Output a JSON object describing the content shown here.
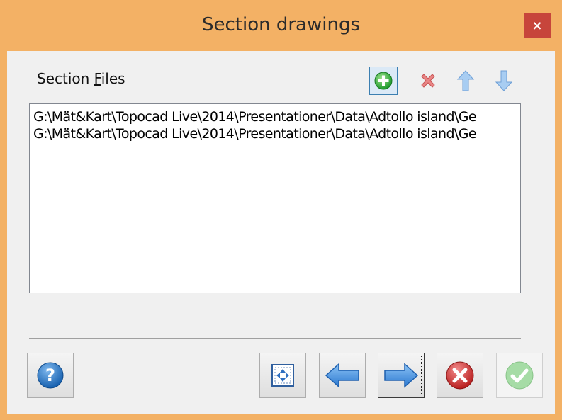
{
  "window": {
    "title": "Section drawings",
    "close_glyph": "×",
    "frame_color": "#f3b165",
    "close_color": "#c7453b"
  },
  "section": {
    "label_prefix": "Section ",
    "label_mnemonic": "F",
    "label_suffix": "iles"
  },
  "toolbar": {
    "add": {
      "icon": "add-icon",
      "color": "#2fae3a"
    },
    "remove": {
      "icon": "remove-icon",
      "color": "#e06a6a"
    },
    "move_up": {
      "icon": "arrow-up-icon",
      "color": "#8fc0ee"
    },
    "move_down": {
      "icon": "arrow-down-icon",
      "color": "#8fc0ee"
    }
  },
  "files": [
    "G:\\Mät&Kart\\Topocad Live\\2014\\Presentationer\\Data\\Adtollo island\\Ge",
    "G:\\Mät&Kart\\Topocad Live\\2014\\Presentationer\\Data\\Adtollo island\\Ge"
  ],
  "buttons": {
    "help": {
      "icon": "help-icon",
      "glyph": "?",
      "color": "#1f6fbf"
    },
    "zoom_extents": {
      "icon": "zoom-extents-icon"
    },
    "back": {
      "icon": "arrow-left-icon",
      "color": "#3d8fe0"
    },
    "next": {
      "icon": "arrow-right-icon",
      "color": "#3d8fe0"
    },
    "cancel": {
      "icon": "cancel-icon",
      "color": "#d23a3a"
    },
    "finish": {
      "icon": "checkmark-icon",
      "color": "#8fd28f",
      "enabled": false
    }
  }
}
